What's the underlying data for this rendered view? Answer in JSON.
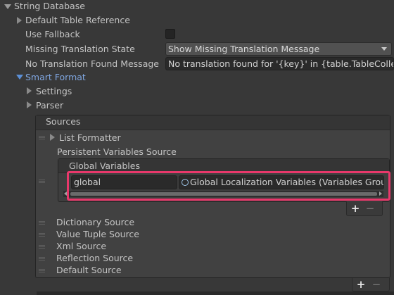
{
  "inspector": {
    "string_database": "String Database",
    "default_table_reference": "Default Table Reference",
    "use_fallback": "Use Fallback",
    "missing_translation_state": "Missing Translation State",
    "missing_translation_value": "Show Missing Translation Message",
    "no_translation_found_message": "No Translation Found Message",
    "no_translation_found_value": "No translation found for '{key}' in {table.TableCollectionName}",
    "smart_format": "Smart Format",
    "settings": "Settings",
    "parser": "Parser"
  },
  "sources": {
    "header": "Sources",
    "list_formatter": "List Formatter",
    "persistent_variables_source": "Persistent Variables Source",
    "global_variables": {
      "header": "Global Variables",
      "name_value": "global",
      "asset_value": "Global Localization Variables (Variables Group Asset)",
      "add_label": "+",
      "remove_label": "−"
    },
    "items": [
      "Dictionary Source",
      "Value Tuple Source",
      "Xml Source",
      "Reflection Source",
      "Default Source"
    ],
    "add_label": "+",
    "remove_label": "−"
  },
  "colors": {
    "background": "#383838",
    "highlight": "#e8386b",
    "link_blue": "#7fa6e0"
  }
}
